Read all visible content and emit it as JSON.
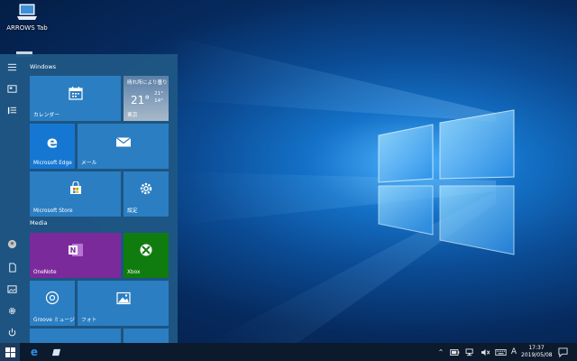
{
  "desktop": {
    "icons": [
      {
        "label": "ARROWS Tab",
        "icon": "laptop-icon"
      }
    ]
  },
  "start_menu": {
    "groups": [
      {
        "title": "Windows"
      },
      {
        "title": "Media"
      }
    ],
    "tiles": {
      "calendar": {
        "label": "カレンダー",
        "icon": "calendar-icon"
      },
      "weather": {
        "condition": "晴れ所により曇り",
        "temp": "21°",
        "high": "21°",
        "low": "14°",
        "city": "東京"
      },
      "edge": {
        "label": "Microsoft Edge",
        "icon": "edge-icon"
      },
      "mail": {
        "label": "メール",
        "icon": "mail-icon"
      },
      "store": {
        "label": "Microsoft Store",
        "icon": "store-icon"
      },
      "settings": {
        "label": "設定",
        "icon": "gear-icon"
      },
      "onenote": {
        "label": "OneNote",
        "icon": "onenote-icon"
      },
      "xbox": {
        "label": "Xbox",
        "icon": "xbox-icon"
      },
      "groove": {
        "label": "Groove ミュージ...",
        "icon": "groove-icon"
      },
      "photos": {
        "label": "フォト",
        "icon": "photos-icon"
      }
    },
    "colors": {
      "tile": "#2b7ec2",
      "onenote": "#7b2a9c",
      "xbox": "#107c10",
      "menu_bg": "#1e5684"
    }
  },
  "taskbar": {
    "tray_ime": "A",
    "clock_time": "17:37",
    "clock_date": "2019/05/08"
  }
}
